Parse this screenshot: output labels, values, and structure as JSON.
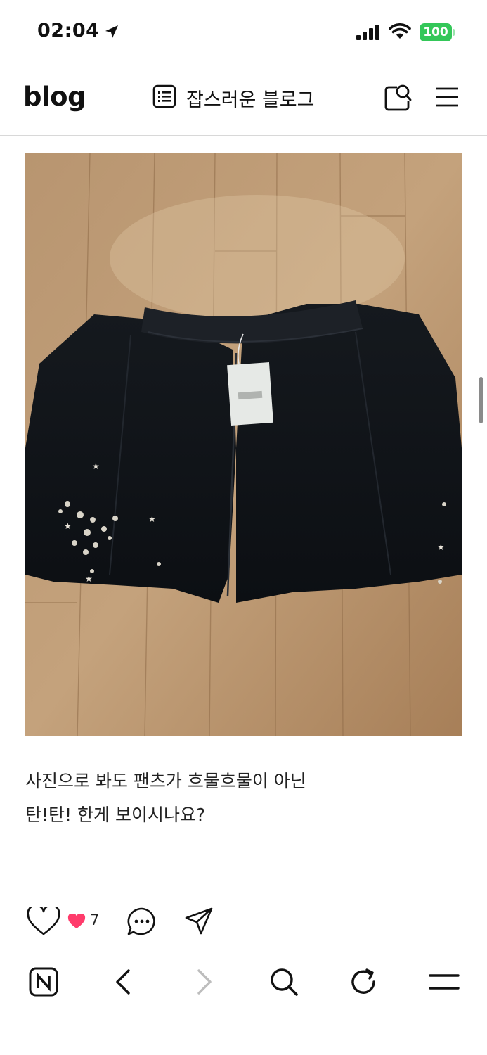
{
  "status_bar": {
    "time": "02:04",
    "battery": "100",
    "icons": [
      "location-arrow-icon",
      "signal-bars-icon",
      "wifi-icon",
      "battery-icon"
    ]
  },
  "header": {
    "brand": "blog",
    "blog_name": "잡스러운 블로그",
    "icons": [
      "list-icon",
      "search-icon",
      "menu-icon"
    ]
  },
  "post": {
    "image_alt": "photo-of-black-pants",
    "text_lines": [
      "사진으로 봐도 팬츠가 흐물흐물이 아닌",
      "탄!탄! 한게 보이시나요?"
    ]
  },
  "actions": {
    "like_count": "7",
    "icons": [
      "heart-icon",
      "like-badge-icon",
      "comment-icon",
      "share-icon"
    ]
  },
  "browser_bar": {
    "icons": [
      "naver-home-icon",
      "back-icon",
      "forward-icon",
      "search-icon",
      "refresh-icon",
      "menu-icon"
    ]
  },
  "colors": {
    "battery": "#34c759",
    "like_badge": "#ff3b6b",
    "divider": "#d8d8d8",
    "floor": "#b08a63"
  }
}
